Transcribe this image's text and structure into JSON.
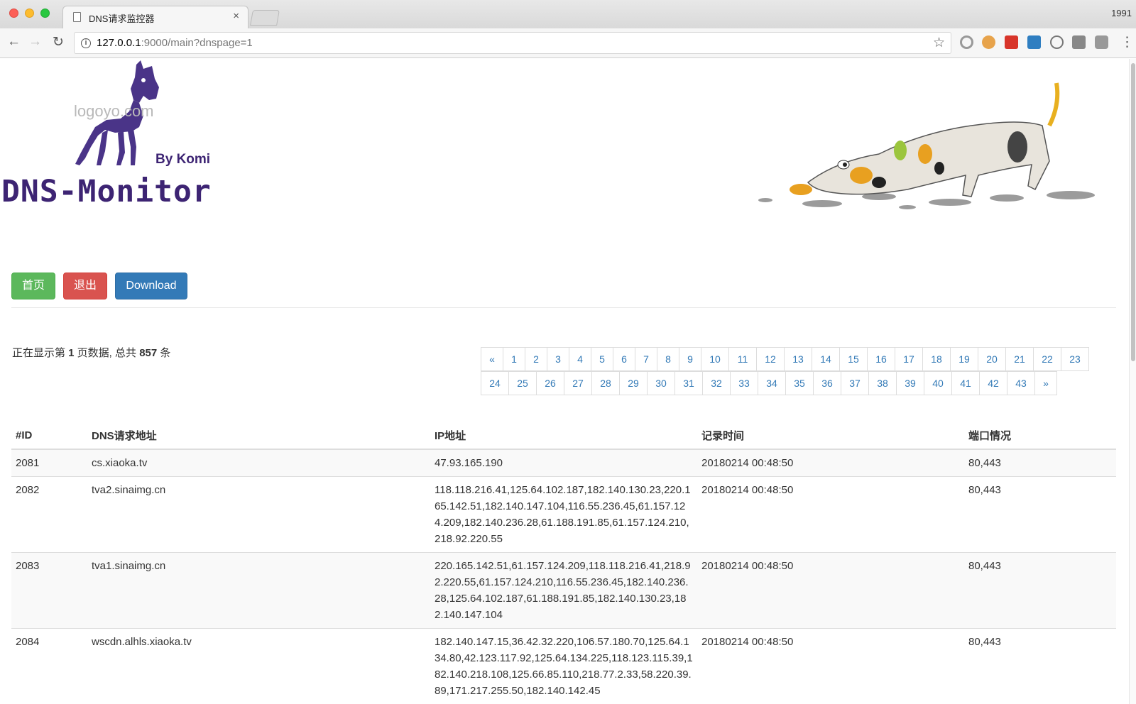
{
  "browser": {
    "tab_title": "DNS请求监控器",
    "tab_close": "×",
    "user_label": "1991",
    "url_host": "127.0.0.1",
    "url_path": ":9000/main?dnspage=1",
    "info_icon": "i",
    "back_icon": "←",
    "forward_icon": "→",
    "reload_icon": "↻",
    "star_icon": "☆",
    "menu_icon": "⋮"
  },
  "header": {
    "logo_text": "DNS-Monitor",
    "by_line": "By Komi",
    "watermark": "logoyo.com"
  },
  "actions": {
    "home_label": "首页",
    "exit_label": "退出",
    "download_label": "Download"
  },
  "summary": {
    "prefix": "正在显示第 ",
    "page": "1",
    "middle": " 页数据, 总共 ",
    "total": "857",
    "suffix": " 条"
  },
  "pagination": {
    "row1": [
      "«",
      "1",
      "2",
      "3",
      "4",
      "5",
      "6",
      "7",
      "8",
      "9",
      "10",
      "11",
      "12",
      "13",
      "14",
      "15",
      "16",
      "17",
      "18",
      "19",
      "20",
      "21",
      "22",
      "23"
    ],
    "row2": [
      "24",
      "25",
      "26",
      "27",
      "28",
      "29",
      "30",
      "31",
      "32",
      "33",
      "34",
      "35",
      "36",
      "37",
      "38",
      "39",
      "40",
      "41",
      "42",
      "43",
      "»"
    ]
  },
  "table": {
    "headers": [
      "#ID",
      "DNS请求地址",
      "IP地址",
      "记录时间",
      "端口情况"
    ],
    "rows": [
      {
        "id": "2081",
        "dns": "cs.xiaoka.tv",
        "ip": "47.93.165.190",
        "time": "20180214 00:48:50",
        "port": "80,443"
      },
      {
        "id": "2082",
        "dns": "tva2.sinaimg.cn",
        "ip": "118.118.216.41,125.64.102.187,182.140.130.23,220.165.142.51,182.140.147.104,116.55.236.45,61.157.124.209,182.140.236.28,61.188.191.85,61.157.124.210,218.92.220.55",
        "time": "20180214 00:48:50",
        "port": "80,443"
      },
      {
        "id": "2083",
        "dns": "tva1.sinaimg.cn",
        "ip": "220.165.142.51,61.157.124.209,118.118.216.41,218.92.220.55,61.157.124.210,116.55.236.45,182.140.236.28,125.64.102.187,61.188.191.85,182.140.130.23,182.140.147.104",
        "time": "20180214 00:48:50",
        "port": "80,443"
      },
      {
        "id": "2084",
        "dns": "wscdn.alhls.xiaoka.tv",
        "ip": "182.140.147.15,36.42.32.220,106.57.180.70,125.64.134.80,42.123.117.92,125.64.134.225,118.123.115.39,182.140.218.108,125.66.85.110,218.77.2.33,58.220.39.89,171.217.255.50,182.140.142.45",
        "time": "20180214 00:48:50",
        "port": "80,443"
      }
    ]
  },
  "colors": {
    "success": "#5cb85c",
    "danger": "#d9534f",
    "primary": "#337ab7",
    "logo": "#3d2473"
  }
}
